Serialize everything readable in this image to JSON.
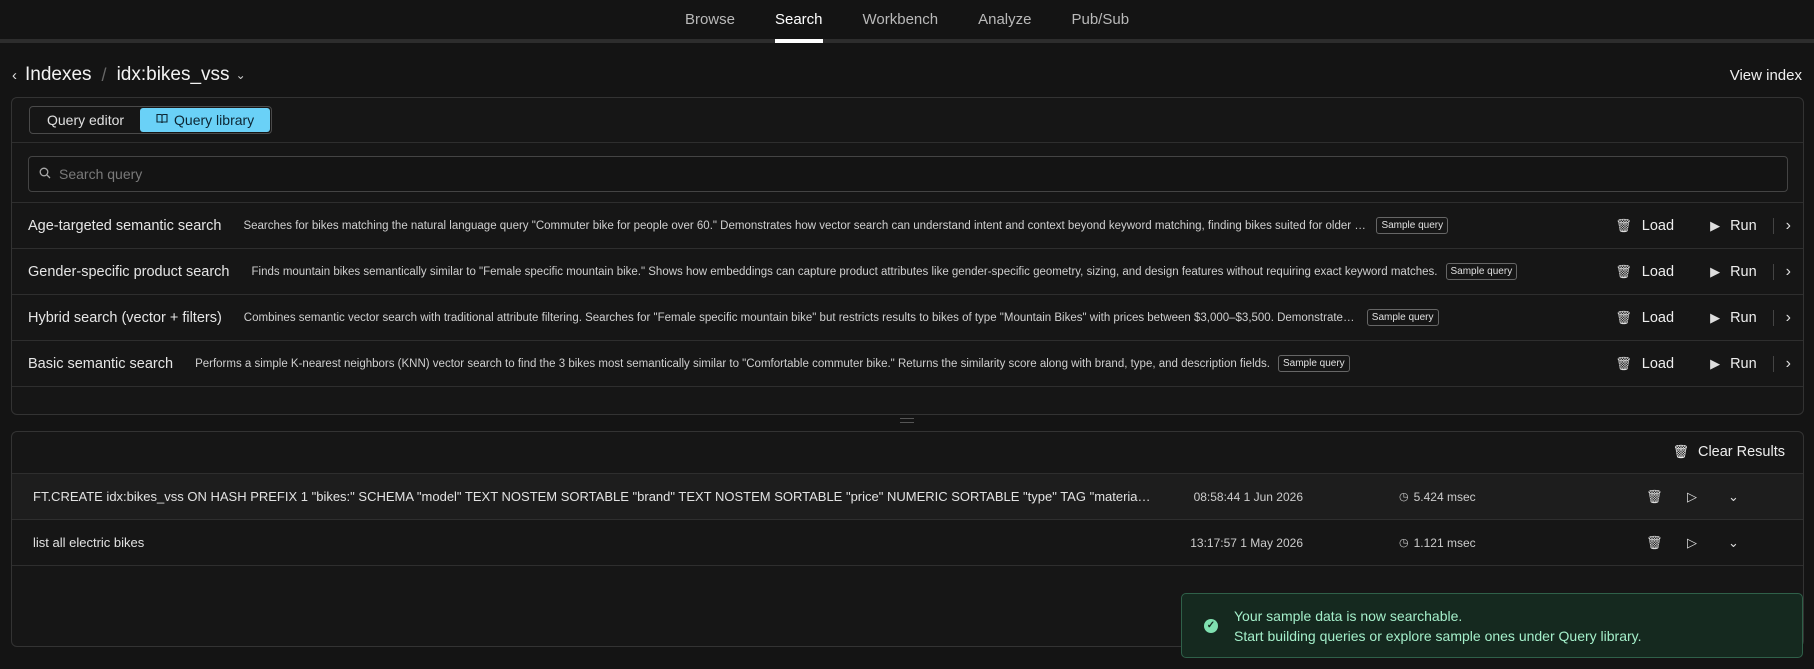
{
  "nav": {
    "tabs": [
      {
        "label": "Browse"
      },
      {
        "label": "Search",
        "active": true
      },
      {
        "label": "Workbench"
      },
      {
        "label": "Analyze"
      },
      {
        "label": "Pub/Sub"
      }
    ]
  },
  "header": {
    "breadcrumb_root": "Indexes",
    "index_name": "idx:bikes_vss",
    "view_index": "View index"
  },
  "toggle": {
    "query_editor": "Query editor",
    "query_library": "Query library"
  },
  "search": {
    "placeholder": "Search query"
  },
  "queries": [
    {
      "title": "Age-targeted semantic search",
      "description": "Searches for bikes matching the natural language query \"Commuter bike for people over 60.\" Demonstrates how vector search can understand intent and context beyond keyword matching, finding bikes suited for older riders prioritizing comfort and ease of use.",
      "badge": "Sample query",
      "load": "Load",
      "run": "Run"
    },
    {
      "title": "Gender-specific product search",
      "description": "Finds mountain bikes semantically similar to \"Female specific mountain bike.\" Shows how embeddings can capture product attributes like gender-specific geometry, sizing, and design features without requiring exact keyword matches.",
      "badge": "Sample query",
      "load": "Load",
      "run": "Run"
    },
    {
      "title": "Hybrid search (vector + filters)",
      "description": "Combines semantic vector search with traditional attribute filtering. Searches for \"Female specific mountain bike\" but restricts results to bikes of type \"Mountain Bikes\" with prices between $3,000–$3,500. Demonstrates pre-filtering before KNN to narrow results.",
      "badge": "Sample query",
      "load": "Load",
      "run": "Run"
    },
    {
      "title": "Basic semantic search",
      "description": "Performs a simple K-nearest neighbors (KNN) vector search to find the 3 bikes most semantically similar to \"Comfortable commuter bike.\" Returns the similarity score along with brand, type, and description fields.",
      "badge": "Sample query",
      "load": "Load",
      "run": "Run"
    }
  ],
  "results": {
    "clear_label": "Clear Results",
    "history": [
      {
        "command": "FT.CREATE idx:bikes_vss ON HASH PREFIX 1 \"bikes:\" SCHEMA \"model\" TEXT NOSTEM SORTABLE \"brand\" TEXT NOSTEM SORTABLE \"price\" NUMERIC SORTABLE \"type\" TAG \"material\" TAG \"weight\" NUMERIC SORTABLE",
        "time": "08:58:44 1 Jun 2026",
        "duration": "5.424 msec"
      },
      {
        "command": "list all electric bikes",
        "time": "13:17:57 1 May 2026",
        "duration": "1.121 msec"
      }
    ]
  },
  "toast": {
    "title": "Your sample data is now searchable.",
    "message": "Start building queries or explore sample ones under Query library."
  },
  "colors": {
    "accent": "#6ad1f7",
    "toast_bg": "#15291f",
    "toast_text": "#a4efca"
  }
}
